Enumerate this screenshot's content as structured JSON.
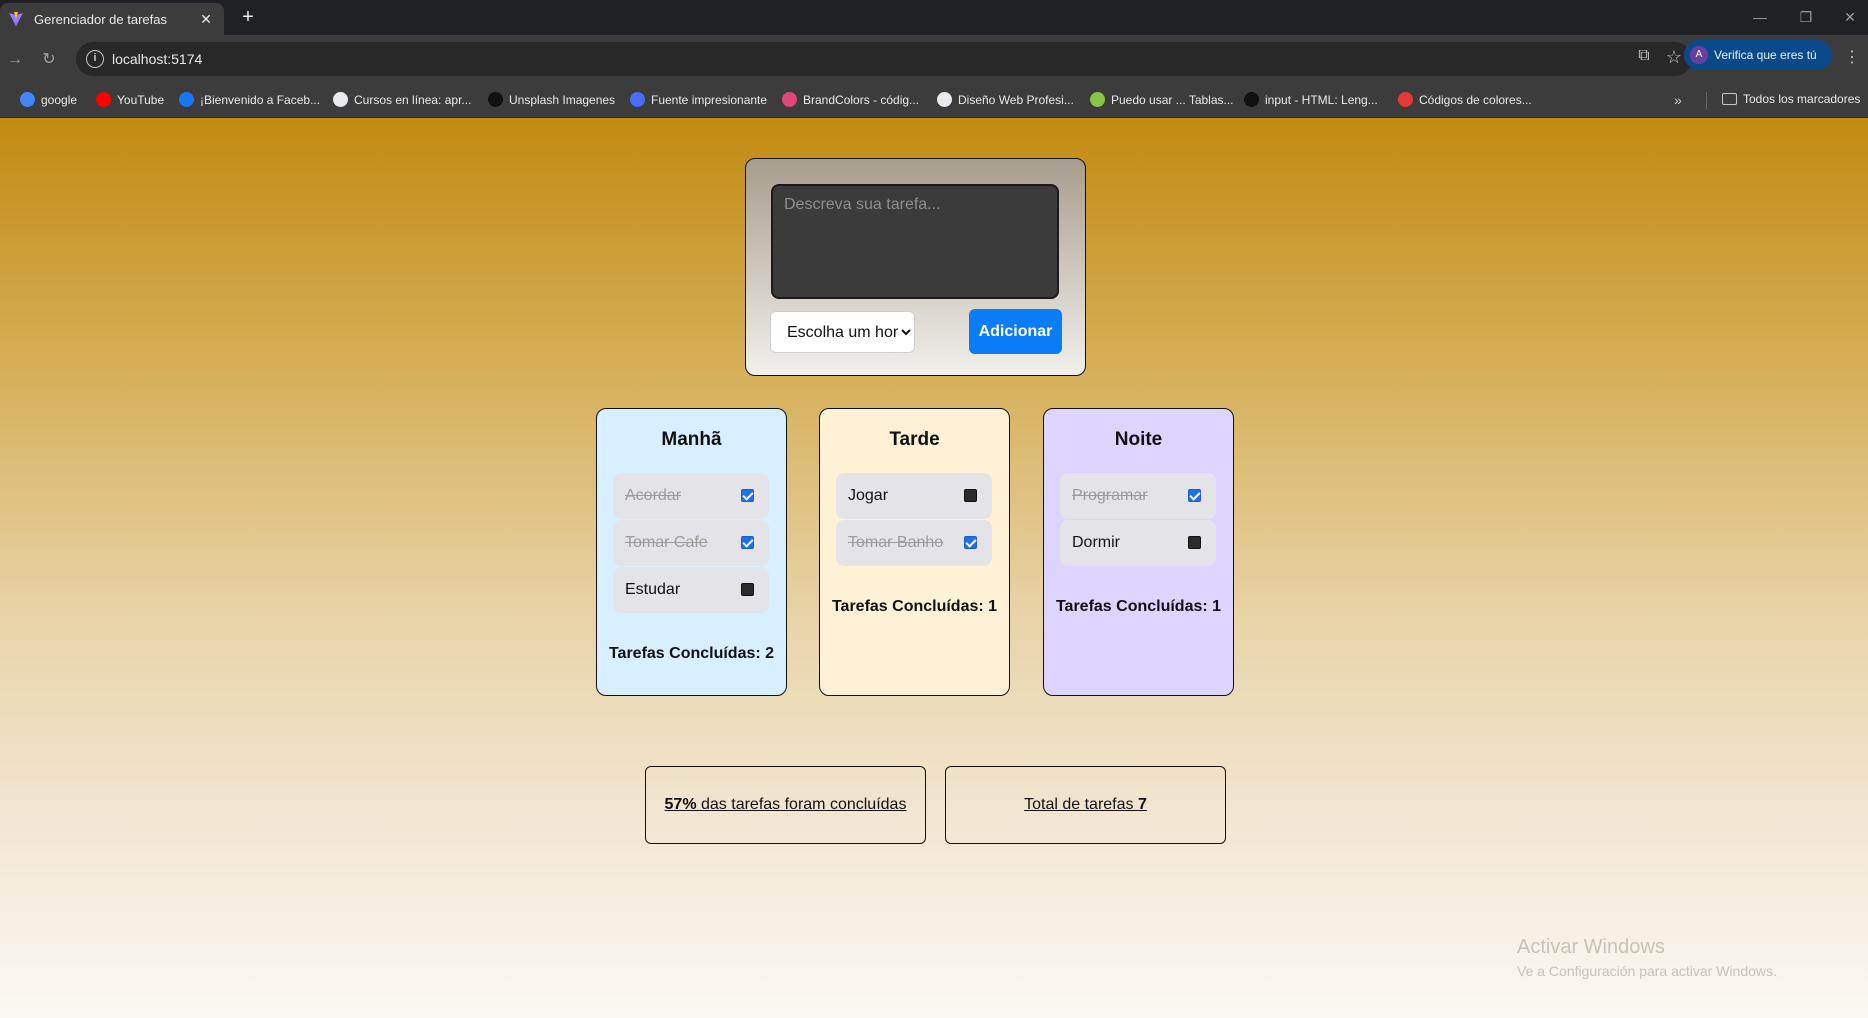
{
  "browser": {
    "tab_title": "Gerenciador de tarefas",
    "url": "localhost:5174",
    "profile_avatar": "A",
    "profile_label": "Verifica que eres tú",
    "bookmarks": [
      {
        "label": "google",
        "color": "#4285f4"
      },
      {
        "label": "YouTube",
        "color": "#ff0000"
      },
      {
        "label": "¡Bienvenido a Faceb...",
        "color": "#1877f2"
      },
      {
        "label": "Cursos en línea: apr...",
        "color": "#e8eaed"
      },
      {
        "label": "Unsplash Imagenes",
        "color": "#111111"
      },
      {
        "label": "Fuente impresionante",
        "color": "#4a6cf7"
      },
      {
        "label": "BrandColors - códig...",
        "color": "#e0457b"
      },
      {
        "label": "Diseño Web Profesi...",
        "color": "#e8eaed"
      },
      {
        "label": "Puedo usar ... Tablas...",
        "color": "#8bc34a"
      },
      {
        "label": "input - HTML: Leng...",
        "color": "#111111"
      },
      {
        "label": "Códigos de colores...",
        "color": "#e53935"
      }
    ],
    "all_bookmarks_label": "Todos los marcadores"
  },
  "form": {
    "placeholder": "Descreva sua tarefa...",
    "select_value": "Escolha um horário",
    "add_label": "Adicionar"
  },
  "periods": [
    {
      "title": "Manhã",
      "background": "#d8efff",
      "tasks": [
        {
          "text": "Acordar",
          "done": true
        },
        {
          "text": "Tomar Cafe",
          "done": true
        },
        {
          "text": "Estudar",
          "done": false
        }
      ],
      "completed_label": "Tarefas Concluídas: 2"
    },
    {
      "title": "Tarde",
      "background": "#fff1d6",
      "tasks": [
        {
          "text": "Jogar",
          "done": false
        },
        {
          "text": "Tomar Banho",
          "done": true
        }
      ],
      "completed_label": "Tarefas Concluídas: 1"
    },
    {
      "title": "Noite",
      "background": "#ddd4ff",
      "tasks": [
        {
          "text": "Programar",
          "done": true
        },
        {
          "text": "Dormir",
          "done": false
        }
      ],
      "completed_label": "Tarefas Concluídas: 1"
    }
  ],
  "stats": {
    "percent_value": "57%",
    "percent_suffix": " das tarefas foram concluídas",
    "total_prefix": "Total de tarefas ",
    "total_value": "7"
  },
  "watermark": {
    "title": "Activar Windows",
    "subtitle": "Ve a Configuración para activar Windows."
  }
}
